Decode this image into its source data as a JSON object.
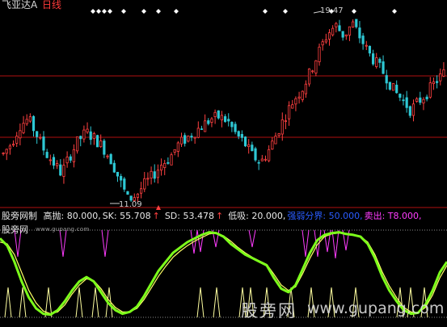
{
  "header": {
    "stock_name": "飞亚达A",
    "period": "日线"
  },
  "indicator": {
    "name": "股旁网制",
    "items": [
      {
        "label": "高抛: 80.000,",
        "color": "#e8e8e8"
      },
      {
        "label": "SK: 55.708",
        "color": "#e8e8e8"
      },
      {
        "label": "↑",
        "color": "#ff4040"
      },
      {
        "label": "SD: 53.478",
        "color": "#e8e8e8"
      },
      {
        "label": "↑",
        "color": "#ff4040"
      },
      {
        "label": "低吸: 20.000,",
        "color": "#e8e8e8"
      },
      {
        "label": "强弱分界: 50.000,",
        "color": "#2a5cff"
      },
      {
        "label": "卖出: T8.000,",
        "color": "#ff3cff"
      }
    ],
    "site_label": "股旁网",
    "site_url": "www.gupang.com"
  },
  "annotations": {
    "high_label": "19.47",
    "low_label": "11.09"
  },
  "watermark": {
    "text_cn": "股旁网",
    "url": "www.gupang.com"
  },
  "colors": {
    "up": "#ff4040",
    "down": "#2ec8d4",
    "sk_line": "#7cff1a",
    "sd_line": "#ffff66",
    "sell_signal": "#ff3cff",
    "buy_signal": "#ffffa0",
    "grid_red": "#b01010"
  },
  "chart_data": [
    {
      "type": "candlestick",
      "title": "飞亚达A 日线",
      "high": 19.47,
      "low": 11.09,
      "trend": [
        13.3,
        13.8,
        14.6,
        14.9,
        14.2,
        13.4,
        12.9,
        12.4,
        13.2,
        13.9,
        14.3,
        14.0,
        13.6,
        13.0,
        12.1,
        11.2,
        11.4,
        11.9,
        12.3,
        12.8,
        13.1,
        13.7,
        14.0,
        14.3,
        14.6,
        14.9,
        15.0,
        14.8,
        14.2,
        13.8,
        13.2,
        12.9,
        13.5,
        14.3,
        15.1,
        15.8,
        16.3,
        17.1,
        18.0,
        18.8,
        19.2,
        18.7,
        19.3,
        18.6,
        17.9,
        17.4,
        16.9,
        16.2,
        15.8,
        15.3,
        15.7,
        16.1,
        16.6,
        17.0
      ]
    },
    {
      "type": "line",
      "title": "股旁网制",
      "ylim": [
        0,
        100
      ],
      "series": [
        {
          "name": "SK",
          "values": [
            88,
            80,
            62,
            40,
            22,
            10,
            4,
            3,
            8,
            18,
            30,
            40,
            45,
            40,
            28,
            16,
            8,
            4,
            6,
            12,
            24,
            38,
            52,
            62,
            72,
            78,
            84,
            88,
            92,
            95,
            94,
            90,
            82,
            76,
            70,
            66,
            62,
            58,
            44,
            32,
            28,
            36,
            54,
            72,
            86,
            92,
            94,
            95,
            93,
            92,
            90,
            82,
            66,
            46,
            30,
            18,
            8,
            4,
            5,
            14,
            30,
            50,
            62
          ]
        },
        {
          "name": "SD",
          "values": [
            84,
            82,
            70,
            50,
            30,
            16,
            7,
            4,
            6,
            14,
            26,
            36,
            43,
            41,
            32,
            20,
            11,
            6,
            6,
            10,
            20,
            33,
            46,
            57,
            67,
            74,
            80,
            85,
            89,
            93,
            94,
            91,
            85,
            78,
            72,
            67,
            63,
            59,
            48,
            36,
            30,
            34,
            49,
            66,
            81,
            90,
            93,
            94,
            93,
            92,
            90,
            84,
            70,
            51,
            35,
            22,
            11,
            6,
            5,
            11,
            25,
            44,
            58
          ]
        }
      ]
    }
  ]
}
